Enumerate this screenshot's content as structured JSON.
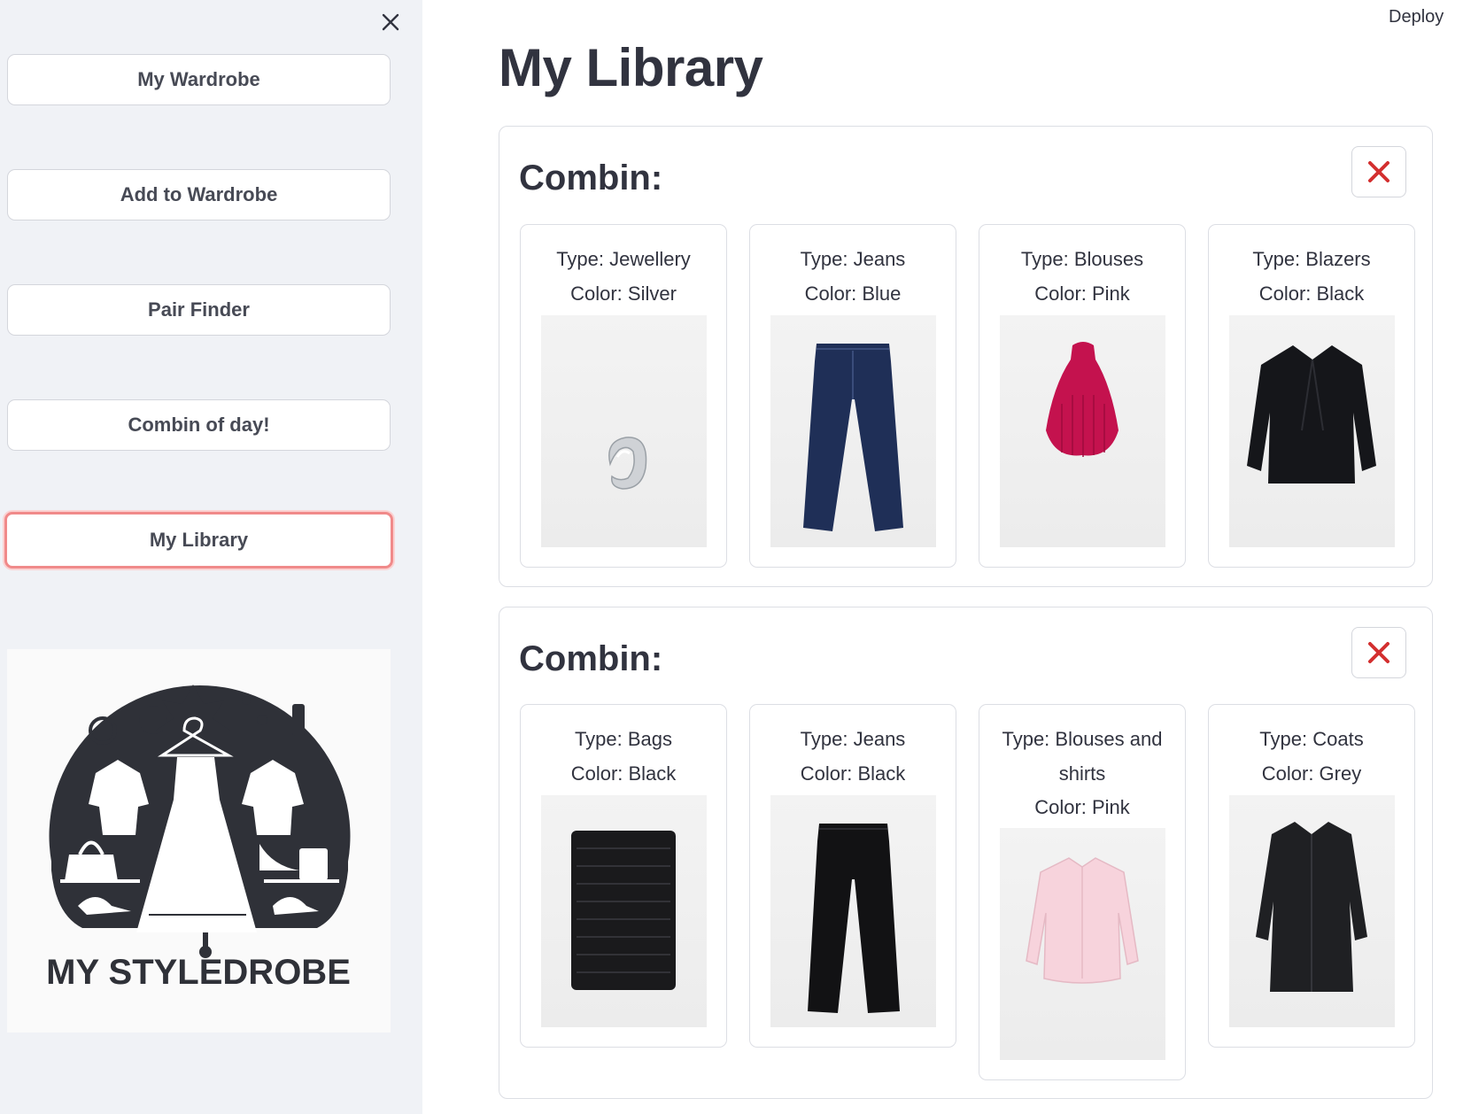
{
  "sidebar": {
    "items": [
      {
        "label": "My Wardrobe"
      },
      {
        "label": "Add to Wardrobe"
      },
      {
        "label": "Pair Finder"
      },
      {
        "label": "Combin of day!"
      },
      {
        "label": "My Library"
      }
    ],
    "logo_text": "MY STYLEDROBE",
    "icons": {
      "close": "close-icon"
    }
  },
  "header": {
    "deploy_label": "Deploy"
  },
  "main": {
    "title": "My Library",
    "combins": [
      {
        "title": "Combin:",
        "items": [
          {
            "type": "Type: Jewellery",
            "color": "Color: Silver",
            "icon": "earring-image"
          },
          {
            "type": "Type: Jeans",
            "color": "Color: Blue",
            "icon": "jeans-image"
          },
          {
            "type": "Type: Blouses",
            "color": "Color: Pink",
            "icon": "blouse-image"
          },
          {
            "type": "Type: Blazers",
            "color": "Color: Black",
            "icon": "blazer-image"
          }
        ]
      },
      {
        "title": "Combin:",
        "items": [
          {
            "type": "Type: Bags",
            "color": "Color: Black",
            "icon": "bag-image"
          },
          {
            "type": "Type: Jeans",
            "color": "Color: Black",
            "icon": "jeans-image"
          },
          {
            "type": "Type: Blouses and shirts",
            "color": "Color: Pink",
            "icon": "shirt-image"
          },
          {
            "type": "Type: Coats",
            "color": "Color: Grey",
            "icon": "coat-image"
          }
        ]
      }
    ]
  },
  "colors": {
    "accent": "#f08a8a",
    "delete": "#d32f2f",
    "sidebar_bg": "#f0f2f6"
  }
}
